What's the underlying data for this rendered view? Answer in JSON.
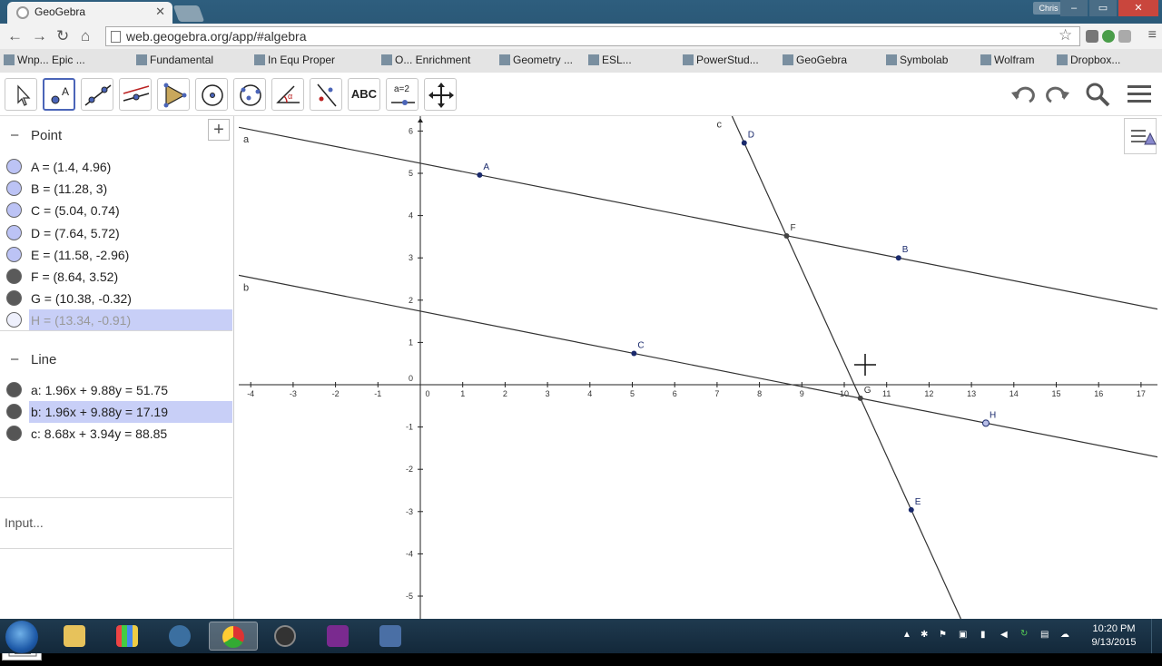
{
  "browser": {
    "tab_title": "GeoGebra",
    "url": "web.geogebra.org/app/#algebra",
    "user_label": "Chris",
    "bookmarks": [
      "Wnp... Epic ...",
      "Fundamental",
      "In Equ Proper",
      "O... Enrichment",
      "Geometry ...",
      "ESL...",
      "PowerStud...",
      "GeoGebra",
      "Symbolab",
      "Wolfram",
      "Dropbox..."
    ]
  },
  "toolbar": {
    "tools": [
      "move",
      "point",
      "line",
      "perpendicular-line",
      "polygon",
      "circle",
      "circle-three-points",
      "angle",
      "reflect",
      "text",
      "slider",
      "move-graphics"
    ],
    "text_tool_label": "ABC",
    "slider_tool_label": "a=2"
  },
  "algebra": {
    "point_group": "Point",
    "line_group": "Line",
    "points": [
      {
        "text": "A = (1.4, 4.96)",
        "color": "#bcc3f5"
      },
      {
        "text": "B = (11.28, 3)",
        "color": "#bcc3f5"
      },
      {
        "text": "C = (5.04, 0.74)",
        "color": "#bcc3f5"
      },
      {
        "text": "D = (7.64, 5.72)",
        "color": "#bcc3f5"
      },
      {
        "text": "E = (11.58, -2.96)",
        "color": "#bcc3f5"
      },
      {
        "text": "F = (8.64, 3.52)",
        "color": "#5a5a5a"
      },
      {
        "text": "G = (10.38, -0.32)",
        "color": "#5a5a5a"
      },
      {
        "text": "H = (13.34, -0.91)",
        "color": "#eef0fc"
      }
    ],
    "lines": [
      {
        "text": "a: 1.96x + 9.88y = 51.75"
      },
      {
        "text": "b: 1.96x + 9.88y = 17.19"
      },
      {
        "text": "c: 8.68x + 3.94y = 88.85"
      }
    ],
    "input_placeholder": "Input..."
  },
  "graph": {
    "x_ticks": [
      -4,
      -3,
      -2,
      -1,
      0,
      1,
      2,
      3,
      4,
      5,
      6,
      7,
      8,
      9,
      10,
      11,
      12,
      13,
      14,
      15,
      16,
      17
    ],
    "y_ticks": [
      -5,
      -4,
      -3,
      -2,
      -1,
      0,
      1,
      2,
      3,
      4,
      5,
      6
    ],
    "points": [
      {
        "name": "A",
        "x": 1.4,
        "y": 4.96
      },
      {
        "name": "B",
        "x": 11.28,
        "y": 3
      },
      {
        "name": "C",
        "x": 5.04,
        "y": 0.74
      },
      {
        "name": "D",
        "x": 7.64,
        "y": 5.72
      },
      {
        "name": "E",
        "x": 11.58,
        "y": -2.96
      },
      {
        "name": "F",
        "x": 8.64,
        "y": 3.52
      },
      {
        "name": "G",
        "x": 10.38,
        "y": -0.32
      },
      {
        "name": "H",
        "x": 13.34,
        "y": -0.91
      }
    ],
    "lines": [
      {
        "name": "a",
        "a": 1.96,
        "b": 9.88,
        "c": 51.75
      },
      {
        "name": "b",
        "a": 1.96,
        "b": 9.88,
        "c": 17.19
      },
      {
        "name": "c",
        "a": 8.68,
        "b": 3.94,
        "c": 88.85
      }
    ],
    "point_color": "#1a2a6c",
    "intersection_color": "#444444"
  },
  "taskbar": {
    "time": "10:20 PM",
    "date": "9/13/2015"
  }
}
